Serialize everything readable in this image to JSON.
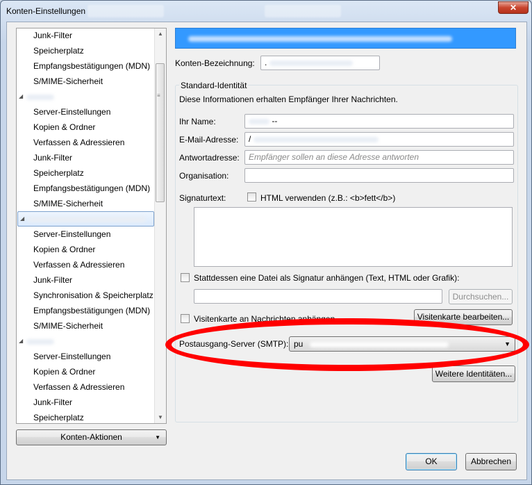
{
  "window": {
    "title": "Konten-Einstellungen",
    "close_glyph": "✕"
  },
  "tree": {
    "items": [
      {
        "label": "Junk-Filter",
        "type": "child"
      },
      {
        "label": "Speicherplatz",
        "type": "child"
      },
      {
        "label": "Empfangsbestätigungen (MDN)",
        "type": "child"
      },
      {
        "label": "S/MIME-Sicherheit",
        "type": "child"
      },
      {
        "label": "",
        "type": "account"
      },
      {
        "label": "Server-Einstellungen",
        "type": "child"
      },
      {
        "label": "Kopien & Ordner",
        "type": "child"
      },
      {
        "label": "Verfassen & Adressieren",
        "type": "child"
      },
      {
        "label": "Junk-Filter",
        "type": "child"
      },
      {
        "label": "Speicherplatz",
        "type": "child"
      },
      {
        "label": "Empfangsbestätigungen (MDN)",
        "type": "child"
      },
      {
        "label": "S/MIME-Sicherheit",
        "type": "child"
      },
      {
        "label": "",
        "type": "account-selected"
      },
      {
        "label": "Server-Einstellungen",
        "type": "child"
      },
      {
        "label": "Kopien & Ordner",
        "type": "child"
      },
      {
        "label": "Verfassen & Adressieren",
        "type": "child"
      },
      {
        "label": "Junk-Filter",
        "type": "child"
      },
      {
        "label": "Synchronisation & Speicherplatz",
        "type": "child"
      },
      {
        "label": "Empfangsbestätigungen (MDN)",
        "type": "child"
      },
      {
        "label": "S/MIME-Sicherheit",
        "type": "child"
      },
      {
        "label": "",
        "type": "account"
      },
      {
        "label": "Server-Einstellungen",
        "type": "child"
      },
      {
        "label": "Kopien & Ordner",
        "type": "child"
      },
      {
        "label": "Verfassen & Adressieren",
        "type": "child"
      },
      {
        "label": "Junk-Filter",
        "type": "child"
      },
      {
        "label": "Speicherplatz",
        "type": "child"
      }
    ]
  },
  "account_actions_label": "Konten-Aktionen",
  "form": {
    "account_name_label": "Konten-Bezeichnung:",
    "account_name_value": ".",
    "group_title": "Standard-Identität",
    "group_desc": "Diese Informationen erhalten Empfänger Ihrer Nachrichten.",
    "name_label": "Ihr Name:",
    "name_value": "--",
    "email_label": "E-Mail-Adresse:",
    "email_value": "/",
    "reply_label": "Antwortadresse:",
    "reply_placeholder": "Empfänger sollen an diese Adresse antworten",
    "org_label": "Organisation:",
    "org_value": "",
    "sig_label": "Signaturtext:",
    "html_check_label": "HTML verwenden (z.B.: <b>fett</b>)",
    "file_sig_label": "Stattdessen eine Datei als Signatur anhängen (Text, HTML oder Grafik):",
    "browse_label": "Durchsuchen...",
    "vcard_label": "Visitenkarte an Nachrichten anhängen",
    "vcard_edit_label": "Visitenkarte bearbeiten...",
    "smtp_label": "Postausgang-Server (SMTP):",
    "smtp_value": "pu",
    "more_identities_label": "Weitere Identitäten..."
  },
  "footer": {
    "ok_label": "OK",
    "cancel_label": "Abbrechen"
  },
  "colors": {
    "banner": "#3399ff",
    "annotation": "#ff0000"
  }
}
